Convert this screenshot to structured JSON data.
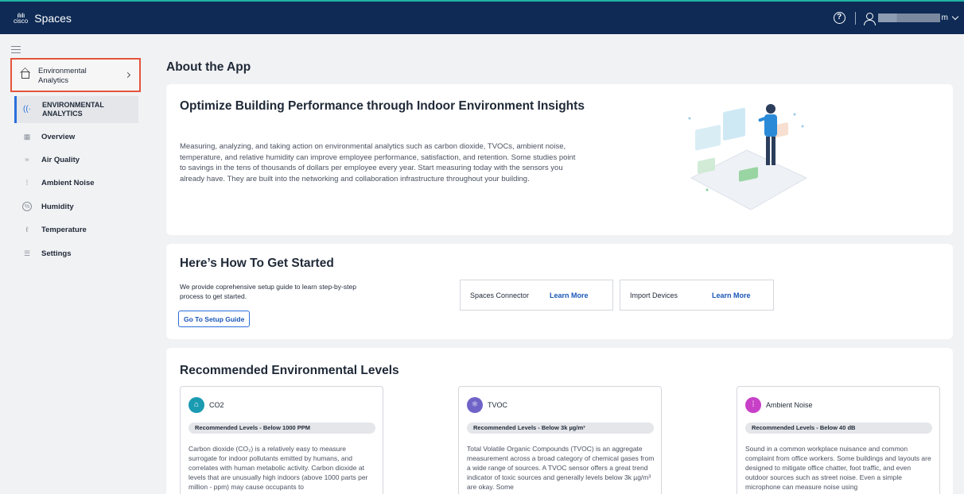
{
  "topbar": {
    "brand_top": "ılıılı",
    "brand_logo_text": "cisco",
    "app_name": "Spaces",
    "help_glyph": "?",
    "user_suffix": "m"
  },
  "sidebar": {
    "app_select_label": "Environmental Analytics",
    "active_label": "ENVIRONMENTAL ANALYTICS",
    "items": [
      {
        "label": "Overview",
        "icon": "grid-icon",
        "glyph": "▦"
      },
      {
        "label": "Air Quality",
        "icon": "air-icon",
        "glyph": "≈"
      },
      {
        "label": "Ambient Noise",
        "icon": "noise-icon",
        "glyph": "⁞"
      },
      {
        "label": "Humidity",
        "icon": "humidity-icon",
        "glyph": "%"
      },
      {
        "label": "Temperature",
        "icon": "thermometer-icon",
        "glyph": "ℓ"
      },
      {
        "label": "Settings",
        "icon": "settings-icon",
        "glyph": "☰"
      }
    ]
  },
  "main": {
    "title": "About the App",
    "about": {
      "heading": "Optimize Building Performance through Indoor Environment Insights",
      "body": "Measuring, analyzing, and taking action on environmental analytics such as carbon dioxide, TVOCs, ambient noise, temperature, and relative humidity can improve employee performance, satisfaction, and retention. Some studies point to savings in the tens of thousands of dollars per employee every year. Start measuring today with the sensors you already have. They are built into the networking and collaboration infrastructure throughout your building."
    },
    "start": {
      "heading": "Here’s How To Get Started",
      "body": "We provide coprehensive setup guide to learn step-by-step process to get started.",
      "button": "Go To Setup Guide",
      "links": [
        {
          "label": "Spaces Connector",
          "link": "Learn More"
        },
        {
          "label": "Import Devices",
          "link": "Learn More"
        }
      ]
    },
    "levels": {
      "heading": "Recommended Environmental Levels",
      "cards": [
        {
          "name": "CO2",
          "icon": "building-icon",
          "glyph": "⌂",
          "color": "#1a9bb2",
          "recommended": "Recommended Levels - Below 1000 PPM",
          "description": "Carbon dioxide (CO₂) is a relatively easy to measure surrogate for indoor pollutants emitted by humans, and correlates with human metabolic activity. Carbon dioxide at levels that are unusually high indoors (above 1000 parts per million - ppm) may cause occupants to"
        },
        {
          "name": "TVOC",
          "icon": "molecule-icon",
          "glyph": "⚛",
          "color": "#6f63c7",
          "recommended": "Recommended Levels - Below 3k µg/m³",
          "description": "Total Volatile Organic Compounds (TVOC) is an aggregate measurement across a broad category of chemical gases from a wide range of sources. A TVOC sensor offers a great trend indicator of toxic sources and generally levels below 3k µg/m³ are okay. Some"
        },
        {
          "name": "Ambient Noise",
          "icon": "soundwave-icon",
          "glyph": "⁞",
          "color": "#c840c8",
          "recommended": "Recommended Levels - Below 40 dB",
          "description": "Sound in a common workplace nuisance and common complaint from office workers. Some buildings and layouts are designed to mitigate office chatter, foot traffic, and even outdoor sources such as street noise. Even a simple microphone can measure noise using"
        }
      ]
    }
  }
}
